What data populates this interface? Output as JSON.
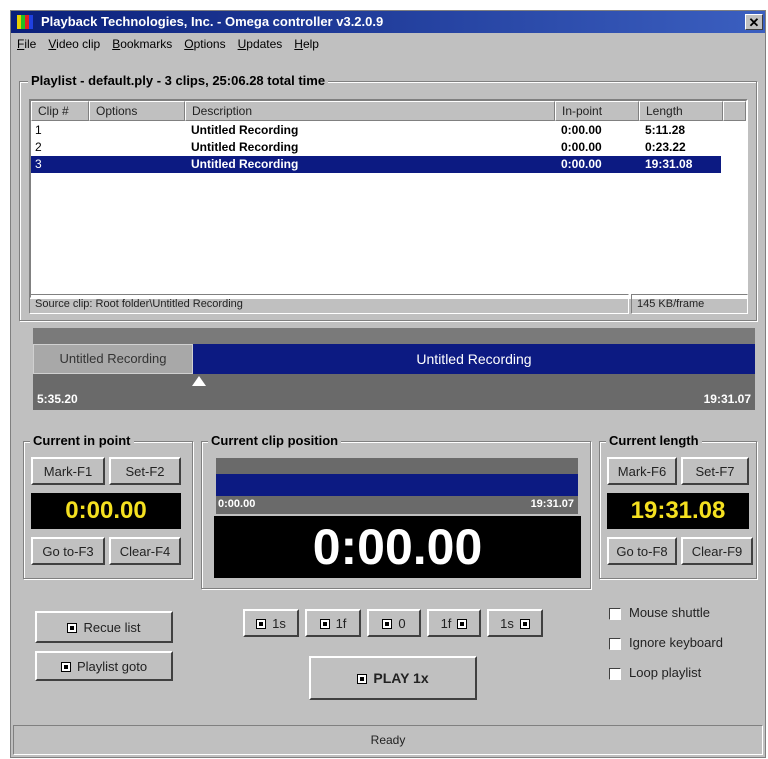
{
  "window": {
    "title": "Playback Technologies, Inc. - Omega controller v3.2.0.9",
    "close_label": "✕"
  },
  "menu": [
    {
      "key": "F",
      "rest": "ile"
    },
    {
      "key": "V",
      "rest": "ideo clip"
    },
    {
      "key": "B",
      "rest": "ookmarks"
    },
    {
      "key": "O",
      "rest": "ptions"
    },
    {
      "key": "U",
      "rest": "pdates"
    },
    {
      "key": "H",
      "rest": "elp"
    }
  ],
  "playlist": {
    "group_label": "Playlist - default.ply - 3 clips, 25:06.28 total time",
    "columns": [
      "Clip #",
      "Options",
      "Description",
      "In-point",
      "Length"
    ],
    "rows": [
      {
        "clip": "1",
        "options": "",
        "description": "Untitled Recording",
        "inpoint": "0:00.00",
        "length": "5:11.28",
        "selected": false
      },
      {
        "clip": "2",
        "options": "",
        "description": "Untitled Recording",
        "inpoint": "0:00.00",
        "length": "0:23.22",
        "selected": false
      },
      {
        "clip": "3",
        "options": "",
        "description": "Untitled Recording",
        "inpoint": "0:00.00",
        "length": "19:31.08",
        "selected": true
      }
    ],
    "source_clip": "Source clip: Root folder\\Untitled Recording",
    "frame_size": "145 KB/frame"
  },
  "timeline": {
    "segment1": "Untitled Recording",
    "segment2": "Untitled Recording",
    "time_left": "5:35.20",
    "time_right": "19:31.07"
  },
  "in_point": {
    "label": "Current in point",
    "mark": "Mark-F1",
    "set": "Set-F2",
    "value": "0:00.00",
    "goto": "Go to-F3",
    "clear": "Clear-F4"
  },
  "position": {
    "label": "Current clip position",
    "start": "0:00.00",
    "end": "19:31.07",
    "value": "0:00.00",
    "progress": 0
  },
  "length": {
    "label": "Current length",
    "mark": "Mark-F6",
    "set": "Set-F7",
    "value": "19:31.08",
    "goto": "Go to-F8",
    "clear": "Clear-F9"
  },
  "controls": {
    "recue": "Recue list",
    "playlist_goto": "Playlist goto",
    "step_back_1s": "1s",
    "step_back_1f": "1f",
    "goto_0": "0",
    "step_fwd_1f": "1f",
    "step_fwd_1s": "1s",
    "play": "PLAY 1x"
  },
  "options": {
    "mouse_shuttle": "Mouse shuttle",
    "ignore_keyboard": "Ignore keyboard",
    "loop_playlist": "Loop playlist"
  },
  "status": "Ready"
}
